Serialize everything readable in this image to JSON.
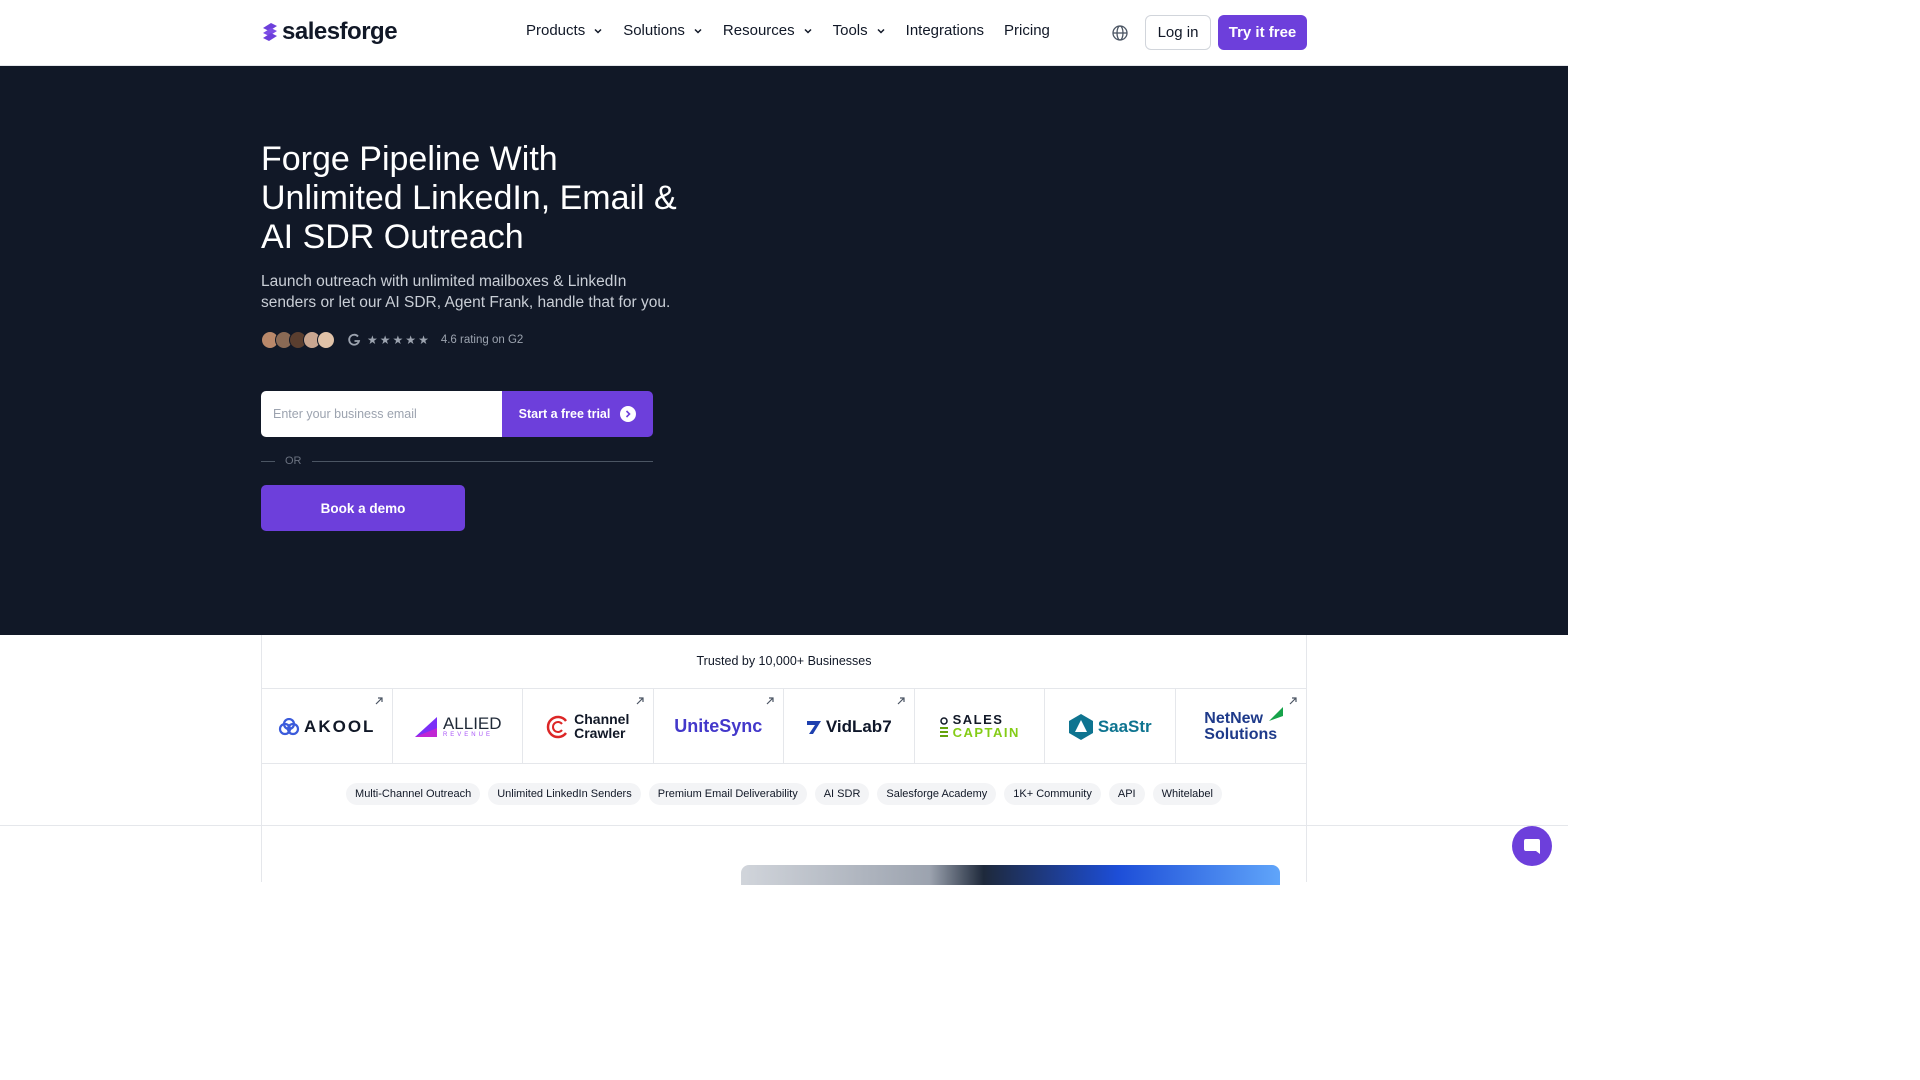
{
  "nav": {
    "logo_text": "salesforge",
    "items": [
      {
        "label": "Products",
        "has_dropdown": true
      },
      {
        "label": "Solutions",
        "has_dropdown": true
      },
      {
        "label": "Resources",
        "has_dropdown": true
      },
      {
        "label": "Tools",
        "has_dropdown": true
      },
      {
        "label": "Integrations",
        "has_dropdown": false
      },
      {
        "label": "Pricing",
        "has_dropdown": false
      }
    ],
    "language_icon": "globe-icon",
    "login_label": "Log in",
    "try_label": "Try it free"
  },
  "hero": {
    "title": "Forge Pipeline With Unlimited LinkedIn, Email & AI SDR Outreach",
    "subtitle": "Launch outreach with unlimited mailboxes & LinkedIn senders or let our AI SDR, Agent Frank, handle that for you.",
    "rating_text": "4.6 rating on G2",
    "rating_value": 4.6,
    "email_placeholder": "Enter your business email",
    "trial_label": "Start a free trial",
    "or_label": "OR",
    "demo_label": "Book a demo"
  },
  "trusted": {
    "title": "Trusted by 10,000+ Businesses",
    "logos": [
      {
        "name": "AKOOL"
      },
      {
        "name": "ALLIED",
        "sub": "REVENUE"
      },
      {
        "name": "Channel",
        "line2": "Crawler"
      },
      {
        "name": "UniteSync"
      },
      {
        "name": "VidLab7"
      },
      {
        "name": "SALES",
        "line2": "CAPTAIN"
      },
      {
        "name": "SaaStr"
      },
      {
        "name": "NetNew",
        "line2": "Solutions"
      }
    ],
    "tags": [
      "Multi-Channel Outreach",
      "Unlimited LinkedIn Senders",
      "Premium Email Deliverability",
      "AI SDR",
      "Salesforge Academy",
      "1K+ Community",
      "API",
      "Whitelabel"
    ]
  },
  "colors": {
    "accent": "#6d3fdb",
    "hero_bg": "#111827"
  }
}
